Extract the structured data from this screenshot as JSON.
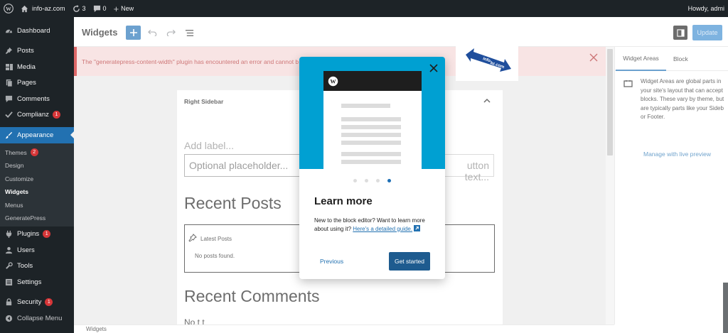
{
  "admin_bar": {
    "site": "info-az.com",
    "updates": "3",
    "comments": "0",
    "new": "New",
    "howdy": "Howdy, admi"
  },
  "sidebar": {
    "items": [
      {
        "label": "Dashboard",
        "icon": "dashboard-icon"
      },
      {
        "label": "Posts",
        "icon": "pin-icon"
      },
      {
        "label": "Media",
        "icon": "media-icon"
      },
      {
        "label": "Pages",
        "icon": "page-icon"
      },
      {
        "label": "Comments",
        "icon": "comment-icon"
      },
      {
        "label": "Complianz",
        "icon": "check-icon",
        "badge": "1"
      },
      {
        "label": "Appearance",
        "icon": "brush-icon"
      },
      {
        "label": "Plugins",
        "icon": "plug-icon",
        "badge": "1"
      },
      {
        "label": "Users",
        "icon": "user-icon"
      },
      {
        "label": "Tools",
        "icon": "wrench-icon"
      },
      {
        "label": "Settings",
        "icon": "settings-icon"
      },
      {
        "label": "Security",
        "icon": "lock-icon",
        "badge": "1"
      },
      {
        "label": "Collapse Menu",
        "icon": "collapse-icon"
      }
    ],
    "appearance_sub": [
      {
        "label": "Themes",
        "badge": "2"
      },
      {
        "label": "Design"
      },
      {
        "label": "Customize"
      },
      {
        "label": "Widgets"
      },
      {
        "label": "Menus"
      },
      {
        "label": "GeneratePress"
      }
    ]
  },
  "toolbar": {
    "title": "Widgets",
    "update_label": "Update"
  },
  "notice": {
    "text": "The \"generatepress-content-width\" plugin has encountered an error and cannot b"
  },
  "canvas": {
    "area_title": "Right Sidebar",
    "add_label": "Add label...",
    "placeholder": "Optional placeholder...",
    "button_text": "utton text...",
    "recent_posts": "Recent Posts",
    "latest_posts": "Latest Posts",
    "no_posts": "No posts found.",
    "recent_comments": "Recent Comments",
    "bottom_peek": "No          t    t"
  },
  "footer": {
    "breadcrumb": "Widgets"
  },
  "inspector": {
    "tab_areas": "Widget Areas",
    "tab_block": "Block",
    "lines": [
      "Widget Areas are global parts in",
      "your site's layout that can accept",
      "blocks. These vary by theme, but",
      "are typically parts like your Sideb",
      "or Footer."
    ],
    "link": "Manage with live preview"
  },
  "modal": {
    "title": "Learn more",
    "body_text": "New to the block editor? Want to learn more about using it?",
    "link_text": "Here's a detailed guide.",
    "previous": "Previous",
    "start": "Get started",
    "total_pages": 4,
    "current_page": 4
  },
  "colors": {
    "admin_dark": "#1d2327",
    "accent": "#2271b1",
    "error": "#cc1818",
    "hero": "#00a0d2"
  }
}
